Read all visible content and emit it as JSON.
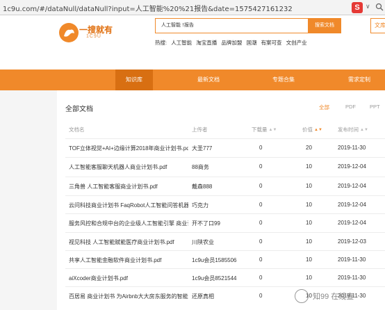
{
  "browser": {
    "url": "1c9u.com/#/dataNull/dataNull?input=人工智能%20%21报告&date=1575427161232",
    "ext_label": "S",
    "drop_glyph": "∨"
  },
  "header": {
    "logo_title": "一搜就有",
    "logo_sub": "1C9U",
    "search_value": "人工智能 !报告",
    "search_button": "搜索文档",
    "contribute_button": "文库",
    "hot_label": "热搜:",
    "hot_items": [
      "人工智能",
      "淘宝直播",
      "品牌加盟",
      "国潮",
      "有案可查",
      "文创产业"
    ]
  },
  "nav": {
    "items": [
      "知识库",
      "最新文档",
      "专题合集",
      "需求定制"
    ],
    "active_index": 0
  },
  "panel": {
    "title": "全部文档",
    "filters": [
      "全部",
      "PDF",
      "PPT"
    ],
    "active_filter": 0
  },
  "table": {
    "headers": {
      "name": "文档名",
      "uploader": "上传者",
      "downloads": "下载量",
      "price": "价值",
      "date": "发布时间"
    },
    "sorted_column": "price",
    "rows": [
      {
        "name": "TOF立体视觉+AI+边缘计算2018年商业计划书.pdf",
        "uploader": "大圣777",
        "downloads": "0",
        "price": "20",
        "date": "2019-11-30"
      },
      {
        "name": "人工智能客服聊天机器人商业计划书.pdf",
        "uploader": "88商务",
        "downloads": "0",
        "price": "10",
        "date": "2019-12-04"
      },
      {
        "name": "三角兽 人工智能客服商业计划书.pdf",
        "uploader": "戴森888",
        "downloads": "0",
        "price": "10",
        "date": "2019-12-04"
      },
      {
        "name": "云问科技商业计划书 FaqRobot人工智能问答机器人.p",
        "uploader": "巧克力",
        "downloads": "0",
        "price": "10",
        "date": "2019-12-04"
      },
      {
        "name": "服务风控和合规中台的企业级人工智能引擎 商业计划书",
        "uploader": "开不了口99",
        "downloads": "0",
        "price": "10",
        "date": "2019-12-04"
      },
      {
        "name": "视见科技 人工智能赋能医疗商业计划书.pdf",
        "uploader": "川陕农业",
        "downloads": "0",
        "price": "10",
        "date": "2019-12-03"
      },
      {
        "name": "共享人工智能金融软件商业计划书.pdf",
        "uploader": "1c9u会员1585506",
        "downloads": "0",
        "price": "10",
        "date": "2019-11-30"
      },
      {
        "name": "aiXcoder商业计划书.pdf",
        "uploader": "1c9u会员8521544",
        "downloads": "0",
        "price": "10",
        "date": "2019-11-30"
      },
      {
        "name": "百居易 商业计划书 为Airbnb大大房东服务的智能民居",
        "uploader": "还原真相",
        "downloads": "0",
        "price": "10",
        "date": "2019-11-30"
      }
    ]
  },
  "watermark": {
    "text": "知99  在线查"
  },
  "colors": {
    "accent": "#f0892a",
    "accent_dark": "#d86f12",
    "browser_bar": "#f3f3f3",
    "gutter": "#f5f5f5"
  }
}
